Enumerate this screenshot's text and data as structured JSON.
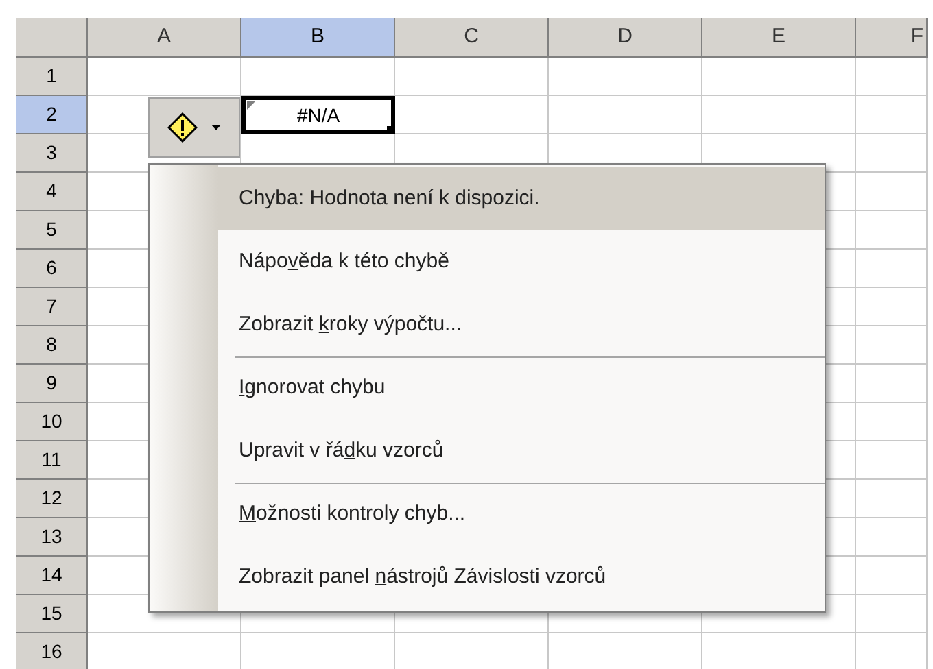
{
  "sheet": {
    "columns": [
      {
        "label": "A",
        "selected": false
      },
      {
        "label": "B",
        "selected": true
      },
      {
        "label": "C",
        "selected": false
      },
      {
        "label": "D",
        "selected": false
      },
      {
        "label": "E",
        "selected": false
      },
      {
        "label": "F",
        "selected": false
      }
    ],
    "rows": [
      {
        "label": "1",
        "selected": false
      },
      {
        "label": "2",
        "selected": true
      },
      {
        "label": "3",
        "selected": false
      },
      {
        "label": "4",
        "selected": false
      },
      {
        "label": "5",
        "selected": false
      },
      {
        "label": "6",
        "selected": false
      },
      {
        "label": "7",
        "selected": false
      },
      {
        "label": "8",
        "selected": false
      },
      {
        "label": "9",
        "selected": false
      },
      {
        "label": "10",
        "selected": false
      },
      {
        "label": "11",
        "selected": false
      },
      {
        "label": "12",
        "selected": false
      },
      {
        "label": "13",
        "selected": false
      },
      {
        "label": "14",
        "selected": false
      },
      {
        "label": "15",
        "selected": false
      },
      {
        "label": "16",
        "selected": false
      }
    ],
    "active_cell": {
      "value": "#N/A",
      "error_flag": true
    }
  },
  "error_menu": {
    "items": [
      {
        "label": {
          "before": "Chyba: Hodnota není k dispozici."
        },
        "highlighted": true,
        "separator_before": false
      },
      {
        "label": {
          "before": "Nápo",
          "key": "v",
          "after": "ěda k této chybě"
        },
        "highlighted": false,
        "separator_before": false
      },
      {
        "label": {
          "before": "Zobrazit ",
          "key": "k",
          "after": "roky výpočtu..."
        },
        "highlighted": false,
        "separator_before": false
      },
      {
        "label": {
          "key": "I",
          "after": "gnorovat chybu"
        },
        "highlighted": false,
        "separator_before": true
      },
      {
        "label": {
          "before": "Upravit v řá",
          "key": "d",
          "after": "ku vzorců"
        },
        "highlighted": false,
        "separator_before": false
      },
      {
        "label": {
          "key": "M",
          "after": "ožnosti kontroly chyb..."
        },
        "highlighted": false,
        "separator_before": true
      },
      {
        "label": {
          "before": "Zobrazit panel ",
          "key": "n",
          "after": "ástrojů Závislosti vzorců"
        },
        "highlighted": false,
        "separator_before": false
      }
    ]
  }
}
